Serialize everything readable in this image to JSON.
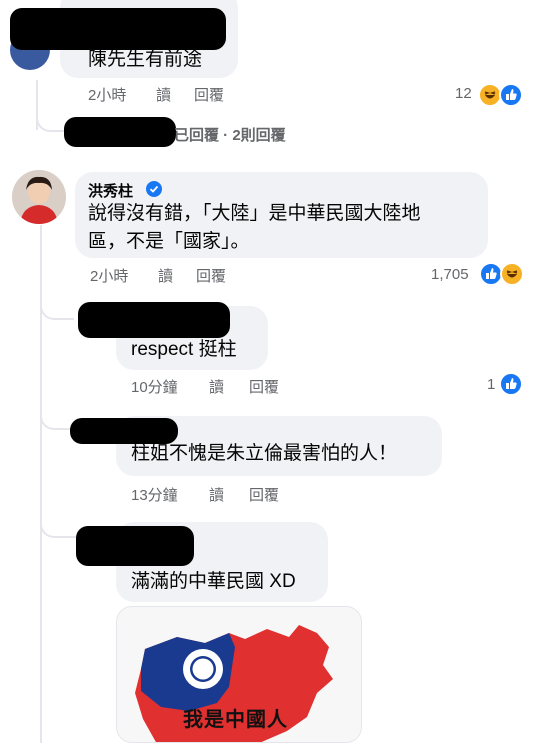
{
  "comments": [
    {
      "text": "陳先生有前途",
      "time": "2小時",
      "read": "讀",
      "reply": "回覆",
      "reactions": "12"
    },
    {
      "author": "洪秀柱",
      "text_line1": "說得沒有錯，「大陸」是中華民國大陸地",
      "text_line2": "區，不是「國家」。",
      "time": "2小時",
      "read": "讀",
      "reply": "回覆",
      "reactions": "1,705"
    }
  ],
  "replies_summary": "已回覆 · 2則回覆",
  "replies": [
    {
      "text": "respect 挺柱",
      "time": "10分鐘",
      "read": "讀",
      "reply": "回覆",
      "reactions": "1"
    },
    {
      "text": "柱姐不愧是朱立倫最害怕的人！",
      "time": "13分鐘",
      "read": "讀",
      "reply": "回覆"
    },
    {
      "text": "滿滿的中華民國 XD",
      "image_caption": "我是中國人"
    }
  ],
  "colors": {
    "bubble": "#f0f2f5",
    "meta": "#65676b",
    "like": "#1877f2",
    "haha": "#f7b125",
    "flag_red": "#e03030",
    "flag_blue": "#1a3a8f"
  }
}
